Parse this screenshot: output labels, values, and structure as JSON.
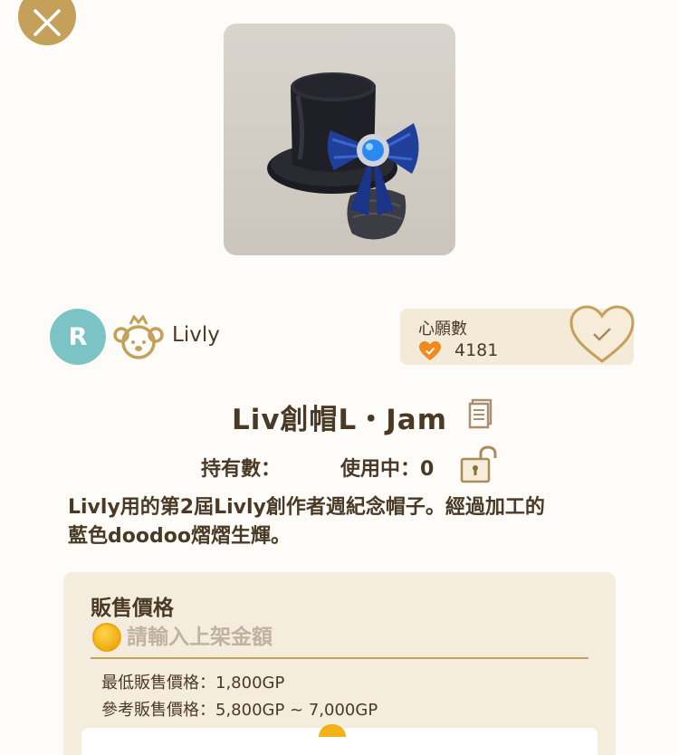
{
  "header": {
    "close_icon": "close-icon"
  },
  "item": {
    "image_icon": "top-hat-with-blue-bow",
    "title": "Liv創帽L・Jam",
    "description_line1": "Livly用的第2屆Livly創作者週紀念帽子。經過加工的",
    "description_line2": "藍色doodoo熠熠生輝。"
  },
  "creator": {
    "avatar_letter": "R",
    "brand_icon": "bear-crown-icon",
    "brand_name": "Livly"
  },
  "wishlist": {
    "label": "心願數",
    "count": "4181",
    "heart_icon": "heart-check-icon"
  },
  "stats": {
    "owned_label": "持有數：",
    "in_use_label": "使用中：0"
  },
  "sell": {
    "title": "販售價格",
    "input_placeholder": "請輸入上架金額",
    "min_price": "最低販售價格：1,800GP",
    "ref_price": "參考販售價格：5,800GP ~ 7,000GP"
  },
  "colors": {
    "accent": "#c4a05a",
    "panel": "#f4ecdd",
    "wish_panel": "#f3ead8",
    "avatar": "#7cc3c6",
    "coin": "#f2b21a",
    "text": "#4a3a25"
  }
}
